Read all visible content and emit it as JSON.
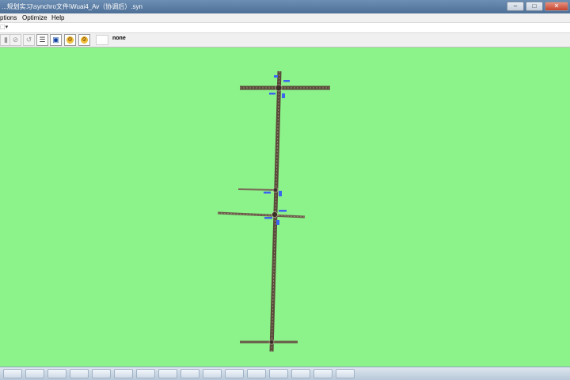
{
  "window": {
    "title": "...规划实习\\synchro文件\\Wuai4_Av（协调后）.syn",
    "controls": {
      "minimize": "–",
      "maximize": "□",
      "close": "✕"
    }
  },
  "menu": {
    "items": [
      {
        "label": "ptions"
      },
      {
        "label": "Optimize"
      },
      {
        "label": "Help"
      }
    ]
  },
  "strip": {
    "dropdown_label": "⬚▾"
  },
  "toolbar": {
    "buttons": [
      {
        "icon": "node-icon",
        "glyph": "▮"
      },
      {
        "icon": "link-icon",
        "glyph": "⊘"
      },
      {
        "icon": "phase-icon",
        "glyph": "↺"
      },
      {
        "icon": "lanes-icon",
        "glyph": "☰"
      },
      {
        "icon": "timing-icon",
        "glyph": "▣"
      },
      {
        "icon": "optimize-icon",
        "glyph": "⚙"
      },
      {
        "icon": "optimize-network-icon",
        "glyph": "⚙"
      }
    ],
    "selection_text": "none"
  },
  "map": {
    "background_color": "#8cf28a",
    "road_color": "#5a4a3a",
    "label_color": "#2a4fe0"
  },
  "taskbar": {
    "apps": [
      "app-1",
      "app-2",
      "app-3",
      "app-4",
      "app-5",
      "app-6",
      "app-7",
      "app-8",
      "app-9",
      "app-10",
      "app-11",
      "app-12",
      "app-13",
      "app-14",
      "app-15",
      "app-16"
    ]
  }
}
